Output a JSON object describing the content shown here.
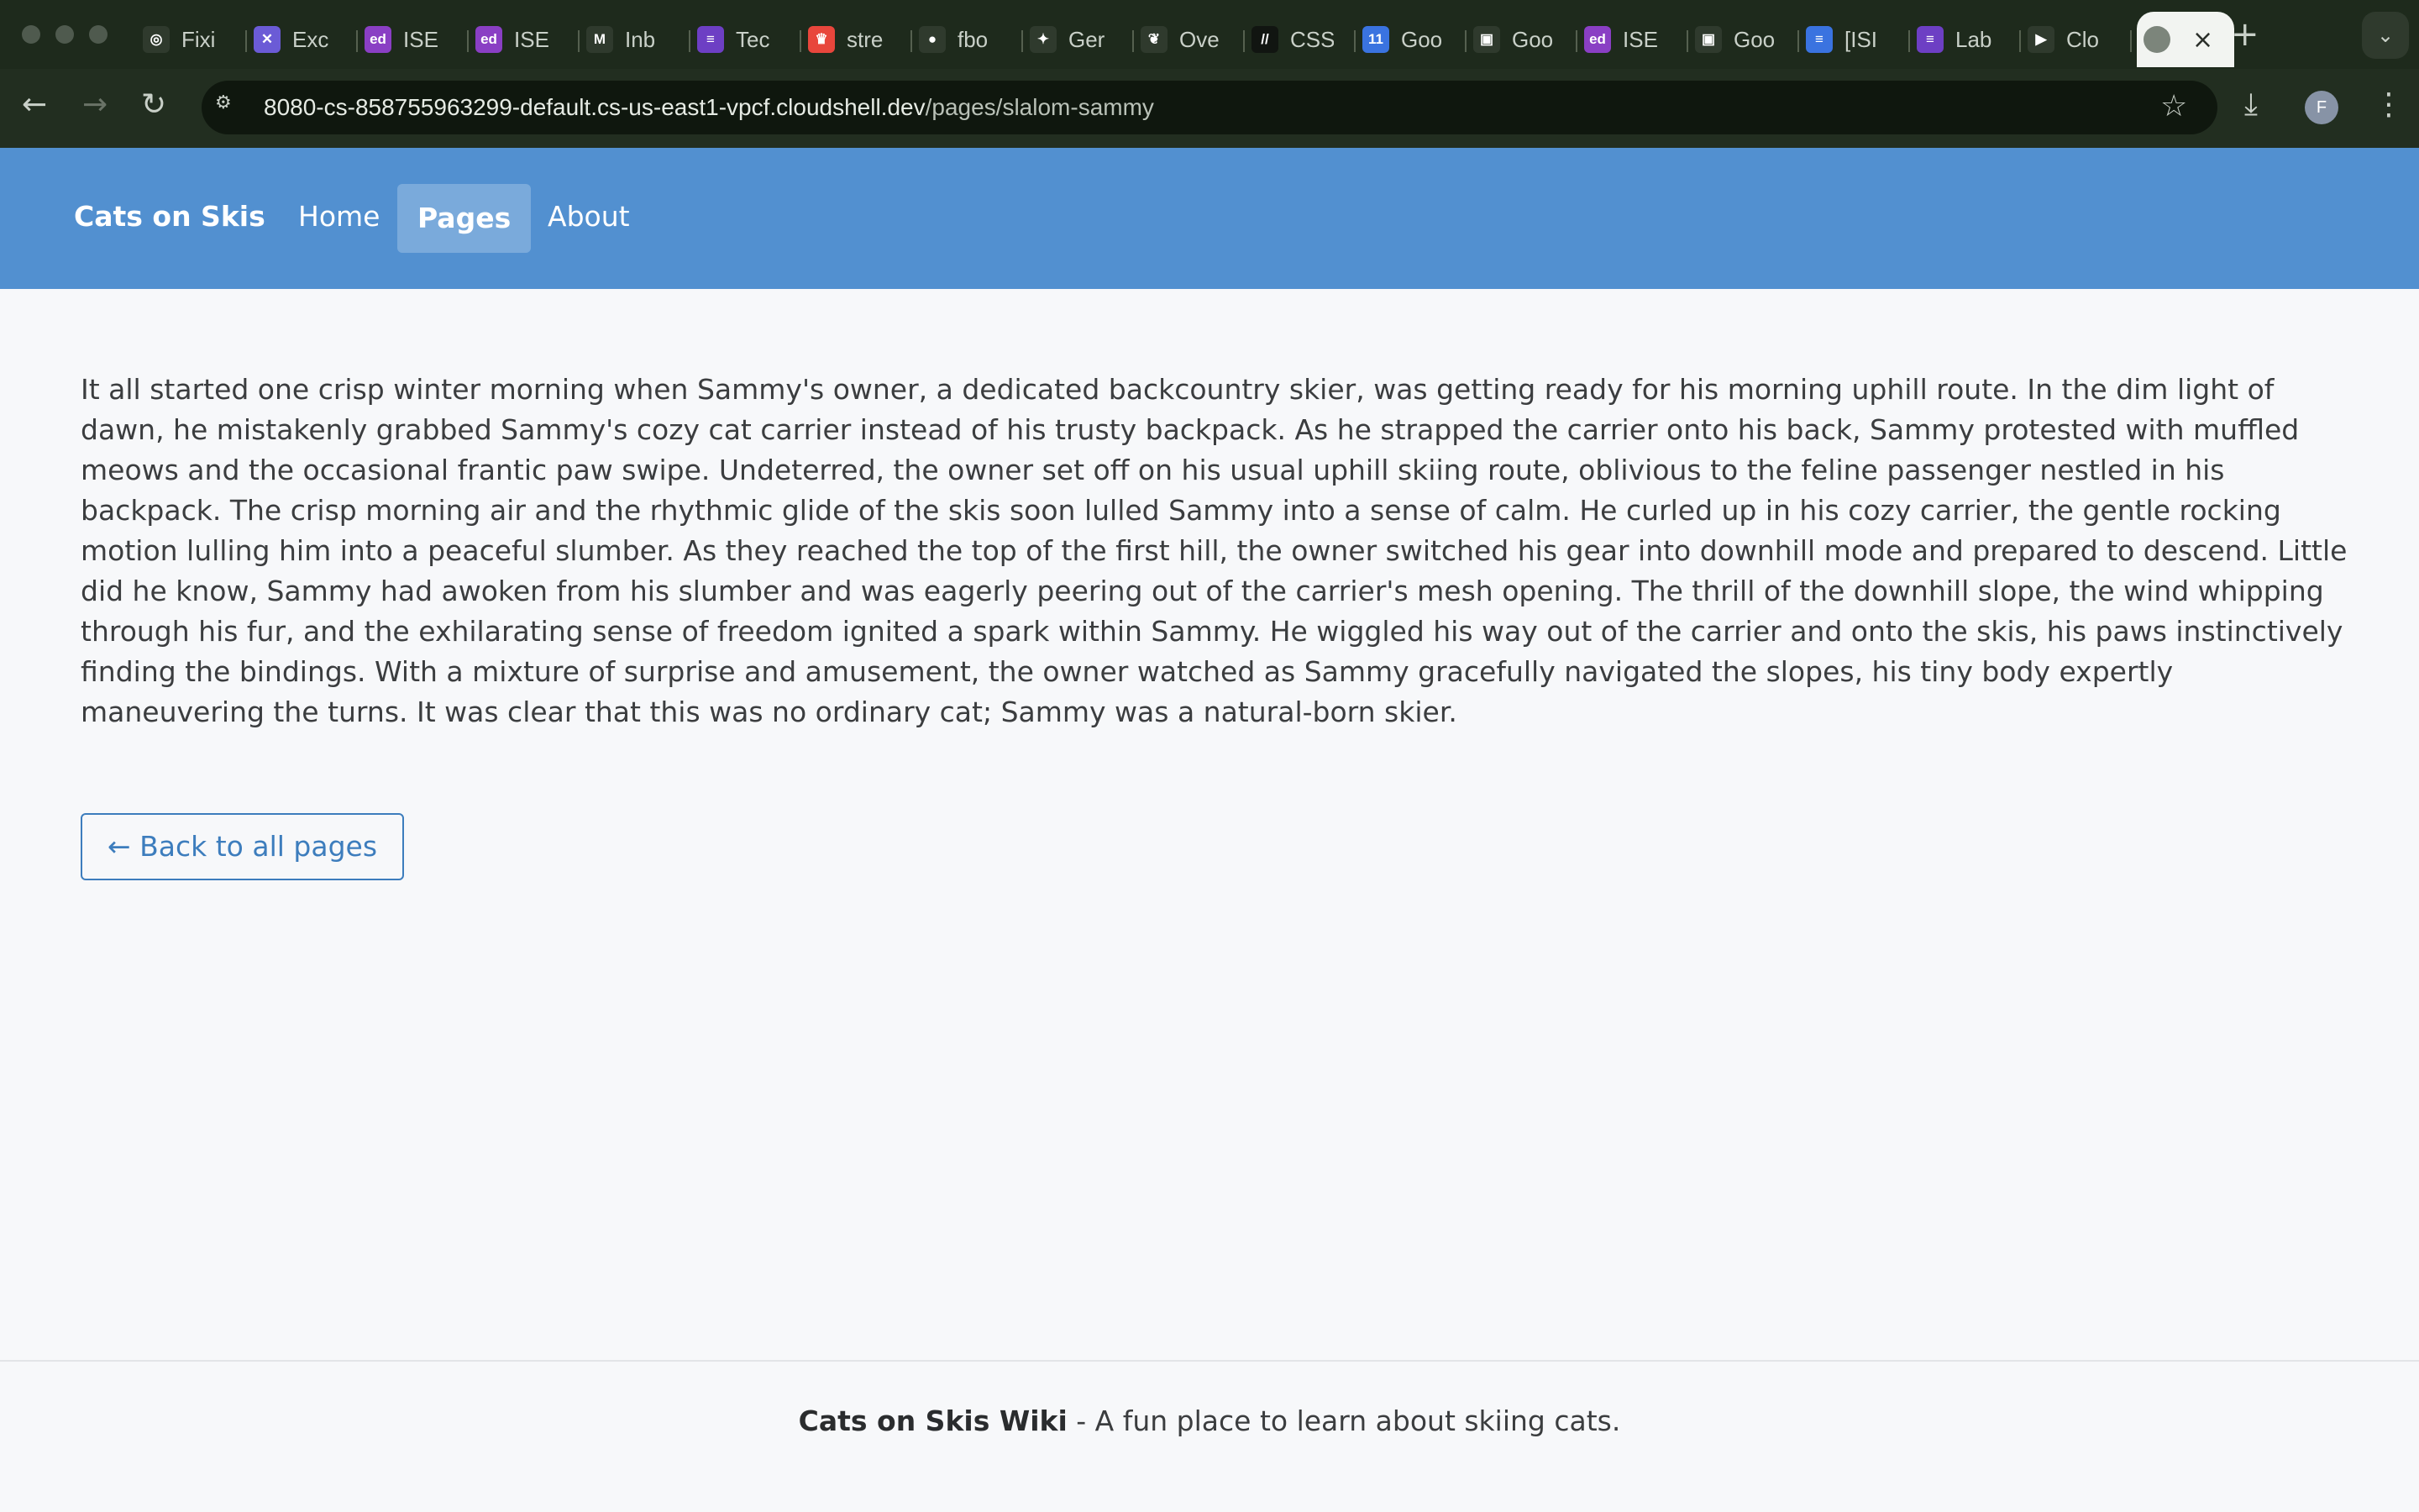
{
  "browser": {
    "tabs": [
      {
        "label": "Fixi",
        "icon": "openai-icon",
        "color": "#2f3a2d",
        "glyph": "◎"
      },
      {
        "label": "Exc",
        "icon": "excalidraw-icon",
        "color": "#6b5bd6",
        "glyph": "✕"
      },
      {
        "label": "ISE",
        "icon": "ed-icon",
        "color": "#8a3fc4",
        "glyph": "ed"
      },
      {
        "label": "ISE",
        "icon": "ed-icon",
        "color": "#8a3fc4",
        "glyph": "ed"
      },
      {
        "label": "Inb",
        "icon": "gmail-icon",
        "color": "#2f3a2d",
        "glyph": "M"
      },
      {
        "label": "Tec",
        "icon": "list-icon",
        "color": "#6d3fc4",
        "glyph": "≡"
      },
      {
        "label": "stre",
        "icon": "streamlit-icon",
        "color": "#e8463c",
        "glyph": "♛"
      },
      {
        "label": "fbo",
        "icon": "github-icon",
        "color": "#2f3a2d",
        "glyph": "●"
      },
      {
        "label": "Ger",
        "icon": "gemini-icon",
        "color": "#2f3a2d",
        "glyph": "✦"
      },
      {
        "label": "Ove",
        "icon": "overleaf-icon",
        "color": "#2f3a2d",
        "glyph": "❦"
      },
      {
        "label": "CSS",
        "icon": "css-icon",
        "color": "#111511",
        "glyph": "//"
      },
      {
        "label": "Goo",
        "icon": "calendar-icon",
        "color": "#3a73e0",
        "glyph": "11"
      },
      {
        "label": "Goo",
        "icon": "meet-icon",
        "color": "#2f3a2d",
        "glyph": "▣"
      },
      {
        "label": "ISE",
        "icon": "ed-icon",
        "color": "#8a3fc4",
        "glyph": "ed"
      },
      {
        "label": "Goo",
        "icon": "meet-icon",
        "color": "#2f3a2d",
        "glyph": "▣"
      },
      {
        "label": "[ISI",
        "icon": "docs-icon",
        "color": "#3a73e0",
        "glyph": "≡"
      },
      {
        "label": "Lab",
        "icon": "list-icon",
        "color": "#6d3fc4",
        "glyph": "≡"
      },
      {
        "label": "Clo",
        "icon": "cloudshell-icon",
        "color": "#2f3a2d",
        "glyph": "▶"
      }
    ],
    "active_tab_icon": "globe-icon",
    "url_host": "8080-cs-858755963299-default.cs-us-east1-vpcf.cloudshell.dev",
    "url_path": "/pages/slalom-sammy",
    "profile_initial": "F"
  },
  "site": {
    "brand": "Cats on Skis",
    "nav": {
      "home": "Home",
      "pages": "Pages",
      "about": "About"
    }
  },
  "page": {
    "story": "It all started one crisp winter morning when Sammy's owner, a dedicated backcountry skier, was getting ready for his morning uphill route. In the dim light of dawn, he mistakenly grabbed Sammy's cozy cat carrier instead of his trusty backpack. As he strapped the carrier onto his back, Sammy protested with muffled meows and the occasional frantic paw swipe. Undeterred, the owner set off on his usual uphill skiing route, oblivious to the feline passenger nestled in his backpack. The crisp morning air and the rhythmic glide of the skis soon lulled Sammy into a sense of calm. He curled up in his cozy carrier, the gentle rocking motion lulling him into a peaceful slumber. As they reached the top of the first hill, the owner switched his gear into downhill mode and prepared to descend. Little did he know, Sammy had awoken from his slumber and was eagerly peering out of the carrier's mesh opening. The thrill of the downhill slope, the wind whipping through his fur, and the exhilarating sense of freedom ignited a spark within Sammy. He wiggled his way out of the carrier and onto the skis, his paws instinctively finding the bindings. With a mixture of surprise and amusement, the owner watched as Sammy gracefully navigated the slopes, his tiny body expertly maneuvering the turns. It was clear that this was no ordinary cat; Sammy was a natural-born skier.",
    "back_button": "← Back to all pages"
  },
  "footer": {
    "title": "Cats on Skis Wiki",
    "tagline": " - A fun place to learn about skiing cats."
  },
  "colors": {
    "header_bg": "#5290d0",
    "nav_active_bg": "#7aaadb",
    "link_blue": "#3d7dbd",
    "page_bg": "#f7f8fa"
  }
}
